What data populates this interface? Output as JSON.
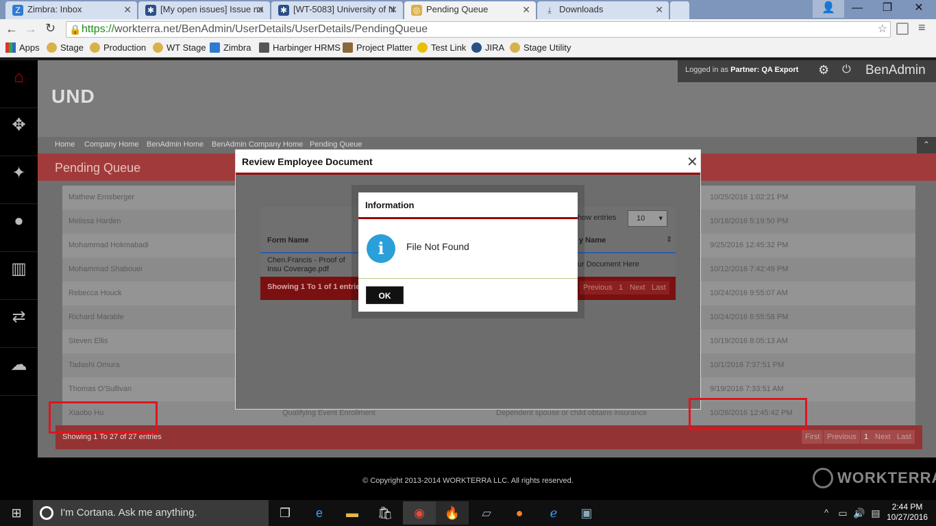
{
  "browser": {
    "tabs": [
      {
        "label": "Zimbra: Inbox",
        "icon": "zimbra-icon",
        "active": false
      },
      {
        "label": "[My open issues] Issue na",
        "icon": "jira-icon",
        "active": false
      },
      {
        "label": "[WT-5083] University of N",
        "icon": "jira-icon",
        "active": false
      },
      {
        "label": "Pending Queue",
        "icon": "workterra-icon",
        "active": true
      },
      {
        "label": "Downloads",
        "icon": "download-icon",
        "active": false
      }
    ],
    "url_scheme": "https://",
    "url_rest": "workterra.net/BenAdmin/UserDetails/UserDetails/PendingQueue",
    "bookmarks": [
      "Apps",
      "Stage",
      "Production",
      "WT Stage",
      "Zimbra",
      "Harbinger HRMS",
      "Project Platter",
      "Test Link",
      "JIRA",
      "Stage Utility"
    ]
  },
  "app": {
    "company": "UND",
    "logged_in_prefix": "Logged in as",
    "logged_in_role": "Partner:",
    "logged_in_user": "QA Export",
    "app_name": "BenAdmin",
    "breadcrumbs": [
      "Home",
      "Company Home",
      "BenAdmin Home",
      "BenAdmin Company Home",
      "Pending Queue"
    ],
    "page_title": "Pending Queue"
  },
  "table": {
    "rows": [
      {
        "name": "Mathew Ernsberger",
        "col2": "",
        "col3": "",
        "date": "10/25/2016 1:02:21 PM"
      },
      {
        "name": "Melissa Harden",
        "col2": "",
        "col3": "",
        "date": "10/18/2016 5:19:50 PM"
      },
      {
        "name": "Mohammad Hokmabadi",
        "col2": "",
        "col3": "",
        "date": "9/25/2016 12:45:32 PM"
      },
      {
        "name": "Mohammad Shabouei",
        "col2": "",
        "col3": "",
        "date": "10/12/2016 7:42:49 PM"
      },
      {
        "name": "Rebecca Houck",
        "col2": "",
        "col3": "",
        "date": "10/24/2016 9:55:07 AM"
      },
      {
        "name": "Richard Marable",
        "col2": "",
        "col3": "",
        "date": "10/24/2016 6:55:58 PM"
      },
      {
        "name": "Steven Ellis",
        "col2": "",
        "col3": "",
        "date": "10/19/2016 8:05:13 AM"
      },
      {
        "name": "Tadashi Omura",
        "col2": "",
        "col3": "",
        "date": "10/1/2016 7:37:51 PM"
      },
      {
        "name": "Thomas O'Sullivan",
        "col2": "",
        "col3": "",
        "date": "9/19/2016 7:33:51 AM"
      },
      {
        "name": "Xiaobo Hu",
        "col2": "Qualifying Event Enrollment",
        "col3": "Dependent spouse or child obtains insurance",
        "date": "10/26/2016 12:45:42 PM"
      }
    ],
    "footer_text": "Showing 1 To 27 of 27 entries",
    "pager": [
      "First",
      "Previous",
      "1",
      "Next",
      "Last"
    ]
  },
  "modal": {
    "title": "Review Employee Document",
    "show_entries_label": "how entries",
    "page_size": "10",
    "col_form_name": "Form Name",
    "col_other": "y Name",
    "row_file": "Chen.Francis - Proof of Insu Coverage.pdf",
    "row_other": "ur Document Here",
    "footer_text": "Showing 1 To 1 of 1 entries",
    "pager": [
      "Previous",
      "1",
      "Next",
      "Last"
    ]
  },
  "dialog": {
    "title": "Information",
    "message": "File Not Found",
    "ok_label": "OK"
  },
  "footer": {
    "copyright": "© Copyright 2013-2014 WORKTERRA LLC. All rights reserved.",
    "brand": "WORKTERRA"
  },
  "taskbar": {
    "search_placeholder": "I'm Cortana. Ask me anything.",
    "time": "2:44 PM",
    "date": "10/27/2016"
  }
}
